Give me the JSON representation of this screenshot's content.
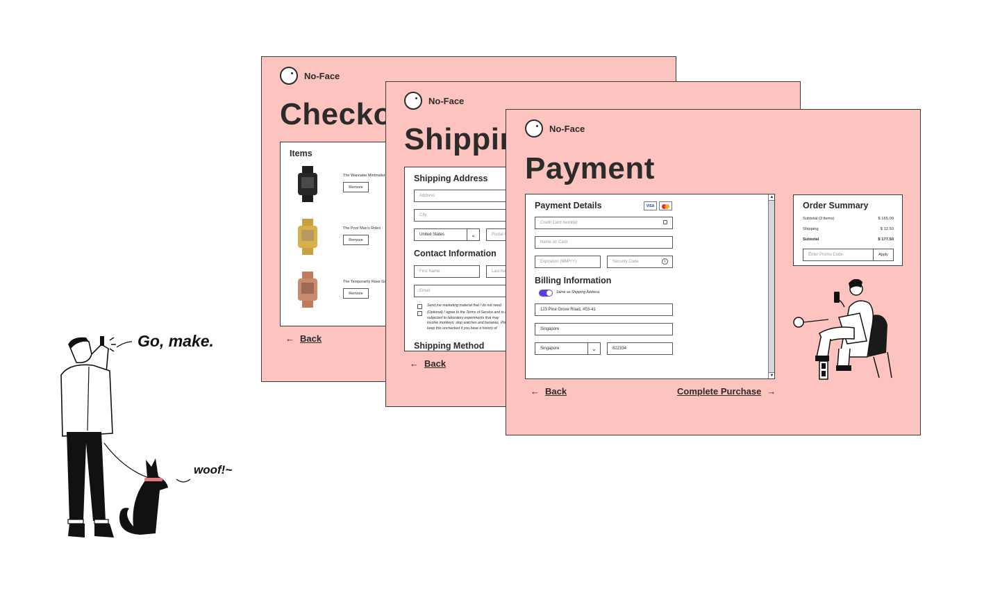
{
  "brand": "No-Face",
  "checkout": {
    "title": "Checkout",
    "items_heading": "Items",
    "items": [
      {
        "name": "The Wannabe Minimalist",
        "action": "Remove"
      },
      {
        "name": "The Poor Man's Rolex",
        "action": "Remove"
      },
      {
        "name": "The Temporarily Rose Gold",
        "action": "Remove"
      }
    ],
    "back": "Back"
  },
  "shipping": {
    "title": "Shipping",
    "address_heading": "Shipping Address",
    "address_placeholder": "Address",
    "city_placeholder": "City",
    "country_value": "United States",
    "postal_placeholder": "Postal Code",
    "contact_heading": "Contact Information",
    "first_name_placeholder": "First Name",
    "last_name_placeholder": "Last Name",
    "email_placeholder": "Email",
    "marketing_text": "Send me marketing material that I do not need.",
    "terms_lines": [
      "(Optional) I agree to the Terms of Service and to be",
      "subjected to laboratory experiments that may",
      "involve monkeys, stop watches and bananas. Please",
      "keep this unchecked if you have a history of"
    ],
    "method_heading": "Shipping Method",
    "back": "Back"
  },
  "payment": {
    "title": "Payment",
    "details_heading": "Payment Details",
    "card_badges": [
      "VISA",
      "Mastercard"
    ],
    "card_number_placeholder": "Credit Card Number",
    "name_on_card_placeholder": "Name on Card",
    "expiration_placeholder": "Expiration (MM/YY)",
    "security_placeholder": "Security Code",
    "billing_heading": "Billing Information",
    "same_as_shipping_label": "Same as Shipping Address.",
    "same_as_shipping_on": true,
    "address_value": "123 Pine Grove Road, #03-41",
    "city_value": "Singapore",
    "country_value": "Singapore",
    "postal_value": "822334",
    "back": "Back",
    "complete": "Complete Purchase"
  },
  "order_summary": {
    "heading": "Order Summary",
    "rows": [
      {
        "label": "Subtotal (3 items)",
        "value": "$ 165.00"
      },
      {
        "label": "Shipping",
        "value": "$ 12.50"
      },
      {
        "label": "Subtotal",
        "value": "$ 177.50"
      }
    ],
    "promo_placeholder": "Enter Promo Code",
    "apply": "Apply"
  },
  "captions": {
    "go_make": "Go, make.",
    "woof": "woof!~"
  },
  "colors": {
    "screen_bg": "#fdc3bf",
    "toggle": "#5a3fe0",
    "ink": "#2b2b2b"
  }
}
